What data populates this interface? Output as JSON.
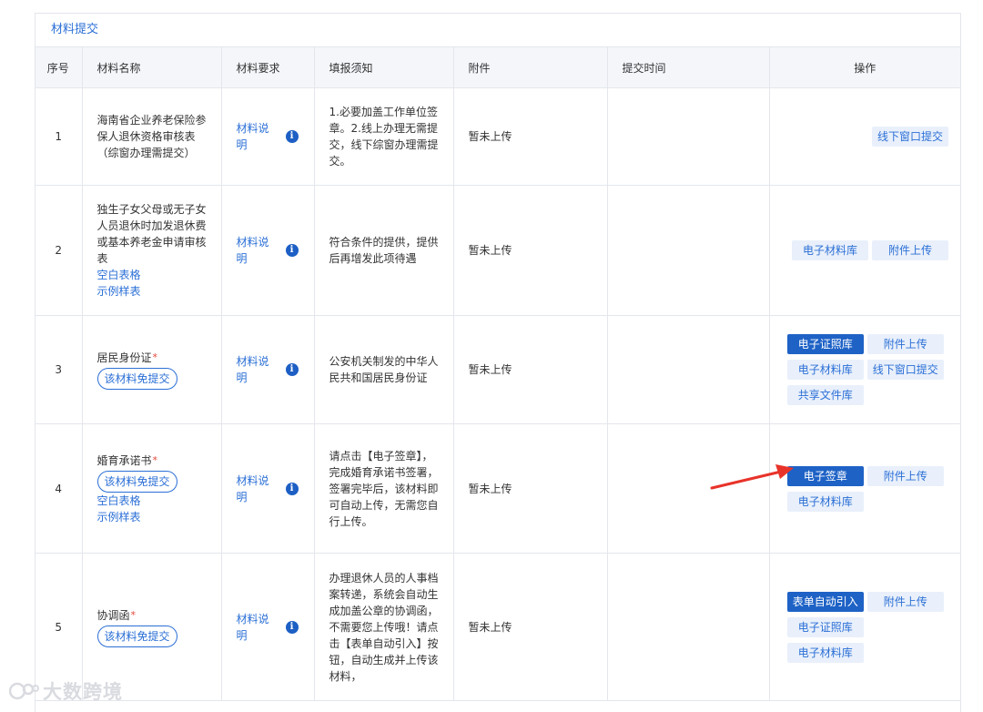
{
  "panel": {
    "title": "材料提交"
  },
  "headers": {
    "num": "序号",
    "name": "材料名称",
    "req": "材料要求",
    "notes": "填报须知",
    "attach": "附件",
    "time": "提交时间",
    "ops": "操作"
  },
  "rows": [
    {
      "num": "1",
      "name": "海南省企业养老保险参保人退休资格审核表（综窗办理需提交）",
      "req": "材料说明",
      "notes": "1.必要加盖工作单位签章。2.线上办理无需提交，线下综窗办理需提交。",
      "attach": "暂未上传",
      "time": "",
      "ops": [
        "线下窗口提交"
      ]
    },
    {
      "num": "2",
      "name": "独生子女父母或无子女人员退休时加发退休费或基本养老金申请审核表",
      "link1": "空白表格",
      "link2": "示例样表",
      "req": "材料说明",
      "notes": "符合条件的提供，提供后再增发此项待遇",
      "attach": "暂未上传",
      "time": "",
      "ops": [
        "电子材料库",
        "附件上传"
      ]
    },
    {
      "num": "3",
      "name": "居民身份证",
      "star": "*",
      "tag": "该材料免提交",
      "req": "材料说明",
      "notes": "公安机关制发的中华人民共和国居民身份证",
      "attach": "暂未上传",
      "time": "",
      "ops": [
        "电子证照库",
        "附件上传",
        "电子材料库",
        "线下窗口提交",
        "共享文件库"
      ]
    },
    {
      "num": "4",
      "name": "婚育承诺书",
      "star": "*",
      "tag": "该材料免提交",
      "link1": "空白表格",
      "link2": "示例样表",
      "req": "材料说明",
      "notes": "请点击【电子签章】，完成婚育承诺书签署，签署完毕后，该材料即可自动上传，无需您自行上传。",
      "attach": "暂未上传",
      "time": "",
      "ops": [
        "电子签章",
        "附件上传",
        "电子材料库"
      ]
    },
    {
      "num": "5",
      "name": "协调函",
      "star": "*",
      "tag": "该材料免提交",
      "req": "材料说明",
      "notes": "办理退休人员的人事档案转递，系统会自动生成加盖公章的协调函，不需要您上传哦！请点击【表单自动引入】按钮，自动生成并上传该材料，",
      "attach": "暂未上传",
      "time": "",
      "ops": [
        "表单自动引入",
        "附件上传",
        "电子证照库",
        "电子材料库"
      ]
    }
  ],
  "icons": {
    "info": "info-icon",
    "arrow": "red-arrow-icon"
  },
  "colors": {
    "accent": "#2b6fd6",
    "primary_button": "#1e62c6",
    "arrow": "#e8332a",
    "star": "#e0463a"
  },
  "watermark": {
    "text": "大数跨境"
  }
}
